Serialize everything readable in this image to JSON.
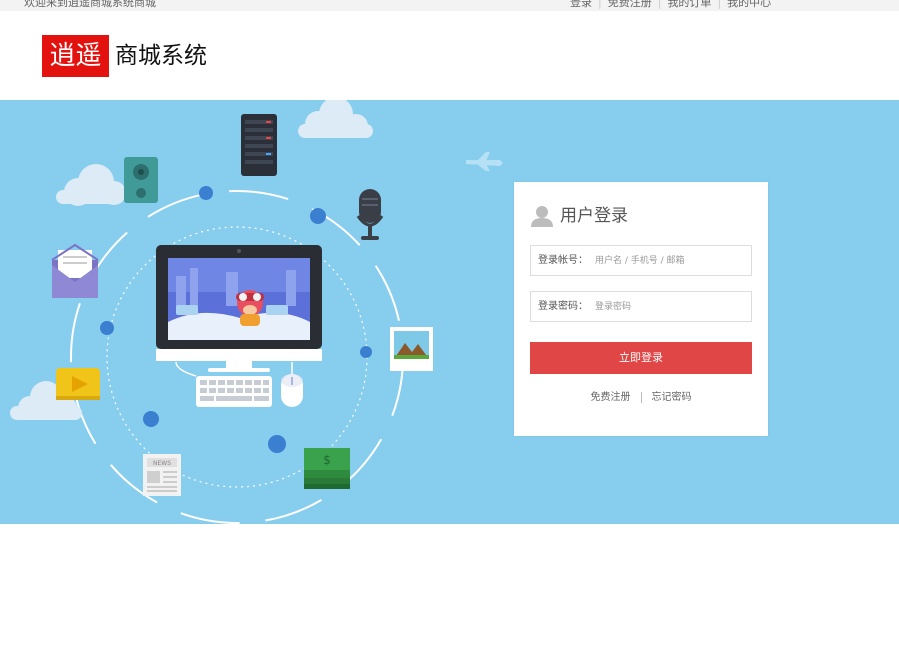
{
  "topbar": {
    "welcome": "欢迎来到逍遥商城系统商城",
    "links": [
      "登录",
      "免费注册",
      "我的订单",
      "我的中心"
    ]
  },
  "header": {
    "logo_mark": "逍遥",
    "logo_text": "商城系统"
  },
  "login": {
    "title": "用户登录",
    "account_label": "登录帐号：",
    "account_placeholder": "用户名 / 手机号 / 邮箱",
    "password_label": "登录密码：",
    "password_placeholder": "登录密码",
    "submit_label": "立即登录",
    "register_link": "免费注册",
    "forgot_link": "忘记密码"
  },
  "banner_art": {
    "newspaper_label": "NEWS",
    "money_label": "$"
  },
  "colors": {
    "brand_red": "#e4120e",
    "banner_blue": "#87cdee",
    "button_red": "#e04646"
  }
}
